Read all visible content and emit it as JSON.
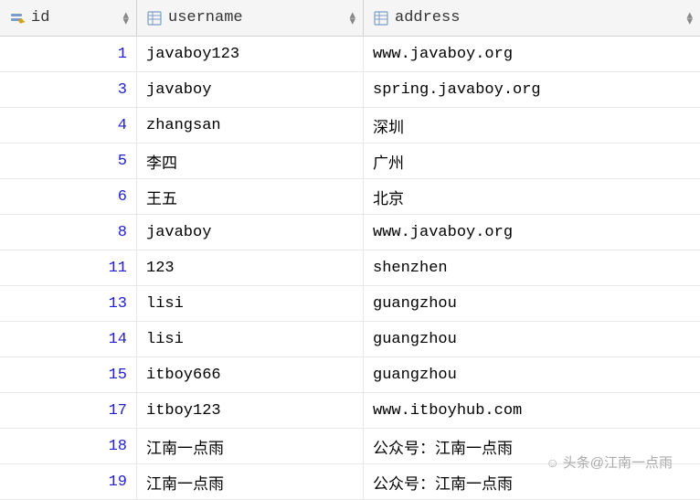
{
  "columns": {
    "id": {
      "label": "id"
    },
    "username": {
      "label": "username"
    },
    "address": {
      "label": "address"
    }
  },
  "rows": [
    {
      "id": "1",
      "username": "javaboy123",
      "address": "www.javaboy.org"
    },
    {
      "id": "3",
      "username": "javaboy",
      "address": "spring.javaboy.org"
    },
    {
      "id": "4",
      "username": "zhangsan",
      "address": "深圳"
    },
    {
      "id": "5",
      "username": "李四",
      "address": "广州"
    },
    {
      "id": "6",
      "username": "王五",
      "address": "北京"
    },
    {
      "id": "8",
      "username": "javaboy",
      "address": "www.javaboy.org"
    },
    {
      "id": "11",
      "username": "123",
      "address": "shenzhen"
    },
    {
      "id": "13",
      "username": "lisi",
      "address": "guangzhou"
    },
    {
      "id": "14",
      "username": "lisi",
      "address": "guangzhou"
    },
    {
      "id": "15",
      "username": "itboy666",
      "address": "guangzhou"
    },
    {
      "id": "17",
      "username": "itboy123",
      "address": "www.itboyhub.com"
    },
    {
      "id": "18",
      "username": "江南一点雨",
      "address": "公众号：江南一点雨"
    },
    {
      "id": "19",
      "username": "江南一点雨",
      "address": "公众号：江南一点雨"
    }
  ],
  "watermark": "头条@江南一点雨"
}
